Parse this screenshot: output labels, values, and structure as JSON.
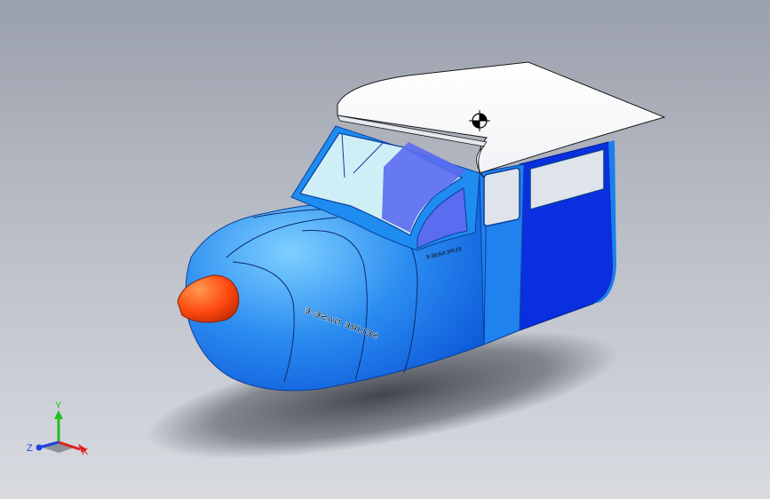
{
  "viewport": {
    "background_top": "#9aa0ac",
    "background_bottom": "#d9dbe1"
  },
  "model": {
    "body_color": "#1f7fe8",
    "body_dark_color": "#0a2fe0",
    "wing_color": "#ffffff",
    "nose_color": "#ff4a10",
    "window_color": "#cfeff7",
    "rear_window_color": "#dfe3ea",
    "inner_panel_color": "#5a6cf0",
    "center_of_mass_icon": "center-of-mass-icon"
  },
  "decals": {
    "side_text": "Ǝ-ƎƧAИ ƎЯIJƎƧ",
    "small_text": "Ǝ-ƎƧAИ ƎЯIJƎ"
  },
  "triad": {
    "x_label": "X",
    "y_label": "Y",
    "z_label": "Z",
    "x_color": "#e02020",
    "y_color": "#20c020",
    "z_color": "#2040e0"
  }
}
